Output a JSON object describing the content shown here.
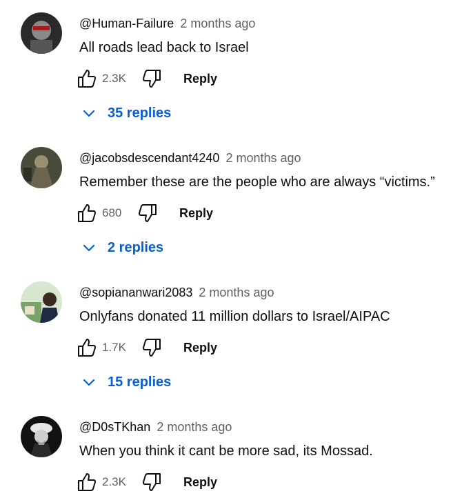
{
  "comments": [
    {
      "author": "@Human-Failure",
      "time": "2 months ago",
      "text": "All roads lead back to Israel",
      "likes": "2.3K",
      "reply_label": "Reply",
      "replies_label": "35 replies"
    },
    {
      "author": "@jacobsdescendant4240",
      "time": "2 months ago",
      "text": "Remember these are the people who are always “victims.”",
      "likes": "680",
      "reply_label": "Reply",
      "replies_label": "2 replies"
    },
    {
      "author": "@sopiananwari2083",
      "time": "2 months ago",
      "text": "Onlyfans donated 11 million dollars to Israel/AIPAC",
      "likes": "1.7K",
      "reply_label": "Reply",
      "replies_label": "15 replies"
    },
    {
      "author": "@D0sTKhan",
      "time": "2 months ago",
      "text": "When you think it cant be more sad, its Mossad.",
      "likes": "2.3K",
      "reply_label": "Reply"
    }
  ],
  "colors": {
    "link": "#065fd4",
    "meta": "#606060",
    "text": "#0f0f0f"
  },
  "icons": [
    "thumb-up-icon",
    "thumb-down-icon",
    "chevron-down-icon",
    "avatar"
  ]
}
